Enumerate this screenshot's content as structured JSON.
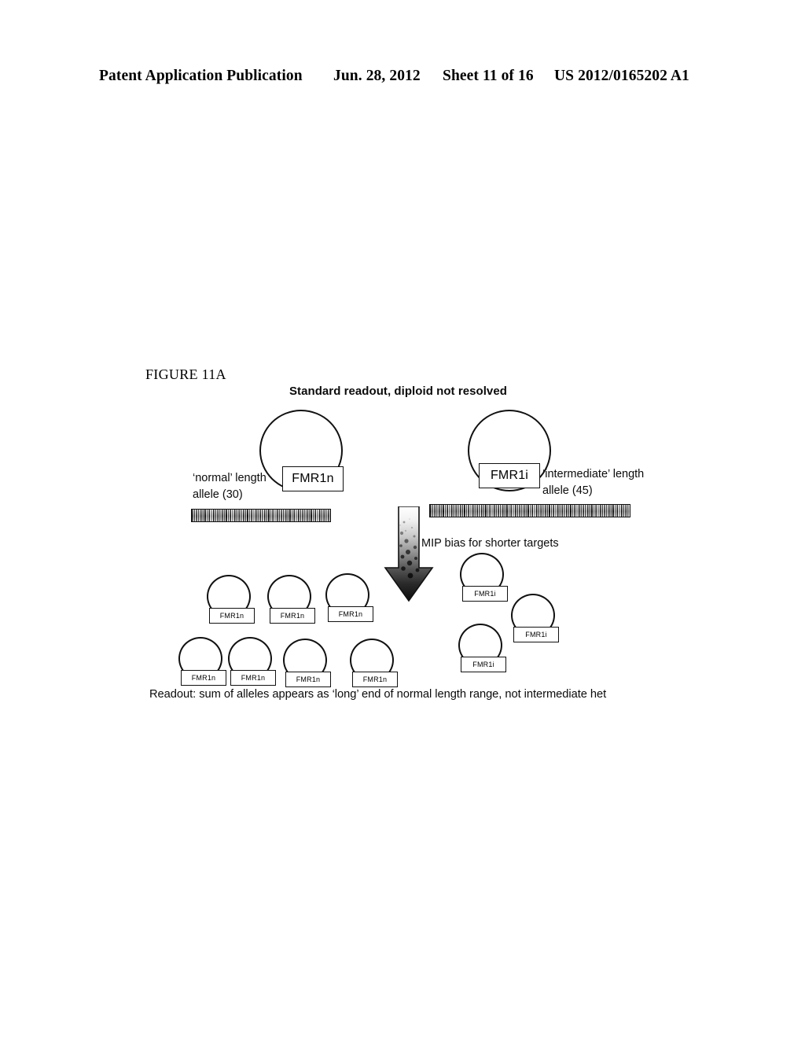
{
  "header": {
    "publication": "Patent Application Publication",
    "date": "Jun. 28, 2012",
    "sheet": "Sheet 11 of 16",
    "patent_number": "US 2012/0165202 A1"
  },
  "figure": {
    "label": "FIGURE 11A",
    "title": "Standard readout, diploid not resolved",
    "mip_bias_label": "MIP bias for shorter targets",
    "caption": "Readout: sum of alleles appears as ‘long’ end of normal length range, not intermediate het"
  },
  "alleles": {
    "normal": {
      "box_label": "FMR1n",
      "description": "‘normal’ length allele (30)",
      "repeat_count": 30
    },
    "intermediate": {
      "box_label": "FMR1i",
      "description": "‘intermediate’ length allele (45)",
      "repeat_count": 45
    }
  },
  "products": {
    "normal_copies": [
      {
        "label": "FMR1n"
      },
      {
        "label": "FMR1n"
      },
      {
        "label": "FMR1n"
      },
      {
        "label": "FMR1n"
      },
      {
        "label": "FMR1n"
      },
      {
        "label": "FMR1n"
      },
      {
        "label": "FMR1n"
      }
    ],
    "intermediate_copies": [
      {
        "label": "FMR1i"
      },
      {
        "label": "FMR1i"
      },
      {
        "label": "FMR1i"
      }
    ]
  },
  "colors": {
    "ink": "#111111",
    "page_background": "#ffffff"
  }
}
